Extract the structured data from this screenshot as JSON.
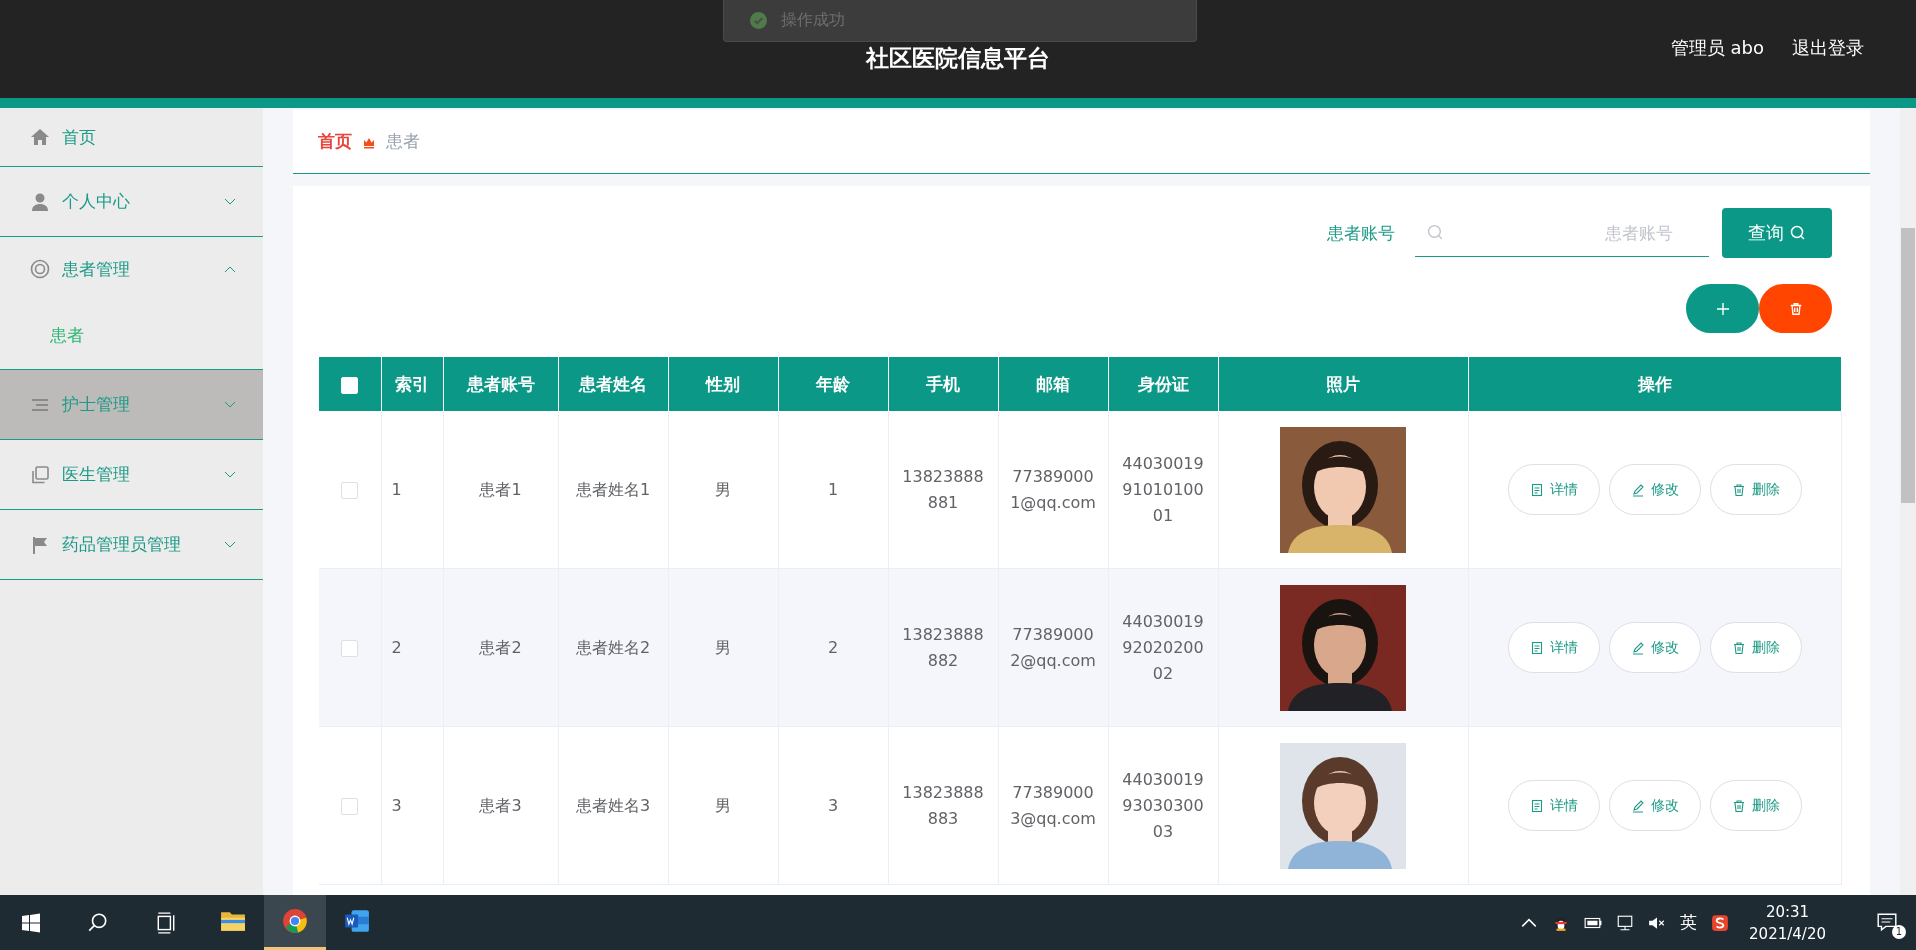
{
  "header": {
    "title": "社区医院信息平台",
    "user": "管理员 abo",
    "logout": "退出登录"
  },
  "toast": {
    "message": "操作成功"
  },
  "sidebar": {
    "items": [
      {
        "label": "首页",
        "highlighted": false
      },
      {
        "label": "个人中心",
        "expanded": false,
        "highlighted": false
      },
      {
        "label": "患者管理",
        "expanded": true,
        "highlighted": false,
        "children": [
          {
            "label": "患者",
            "selected": true
          }
        ]
      },
      {
        "label": "护士管理",
        "expanded": false,
        "highlighted": true
      },
      {
        "label": "医生管理",
        "expanded": false,
        "highlighted": false
      },
      {
        "label": "药品管理员管理",
        "expanded": false,
        "highlighted": false
      }
    ]
  },
  "breadcrumb": [
    "首页",
    "患者"
  ],
  "search": {
    "label": "患者账号",
    "placeholder": "患者账号",
    "button": "查询"
  },
  "table": {
    "select_all": false,
    "columns": [
      "索引",
      "患者账号",
      "患者姓名",
      "性别",
      "年龄",
      "手机",
      "邮箱",
      "身份证",
      "照片",
      "操作"
    ],
    "rows": [
      {
        "checked": false,
        "cells": [
          "1",
          "患者1",
          "患者姓名1",
          "男",
          "1",
          "13823888881",
          "773890001@qq.com",
          "440300199101010001"
        ],
        "actions": [
          "详情",
          "修改",
          "删除"
        ]
      },
      {
        "checked": false,
        "cells": [
          "2",
          "患者2",
          "患者姓名2",
          "男",
          "2",
          "13823888882",
          "773890002@qq.com",
          "440300199202020002"
        ],
        "actions": [
          "详情",
          "修改",
          "删除"
        ]
      },
      {
        "checked": false,
        "cells": [
          "3",
          "患者3",
          "患者姓名3",
          "男",
          "3",
          "13823888883",
          "773890003@qq.com",
          "440300199303030003"
        ],
        "actions": [
          "详情",
          "修改",
          "删除"
        ]
      }
    ]
  },
  "taskbar": {
    "apps": [
      {
        "selected": false
      },
      {
        "selected": true
      },
      {
        "selected": false
      }
    ],
    "language": "英",
    "time": "20:31",
    "date": "2021/4/20",
    "notifications": "1"
  }
}
